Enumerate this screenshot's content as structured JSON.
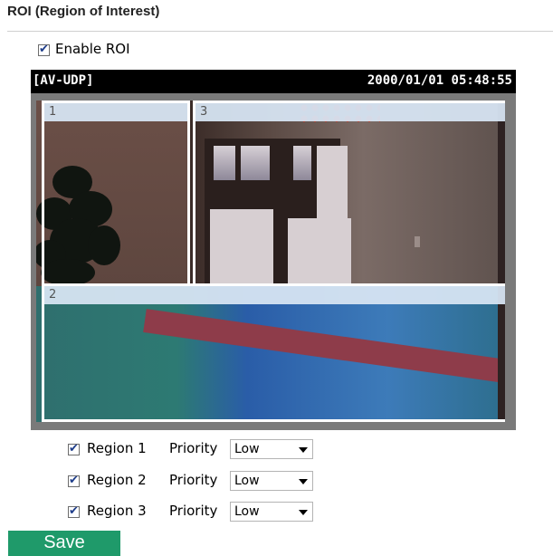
{
  "section": {
    "title": "ROI (Region of Interest)"
  },
  "enable_roi": {
    "label": "Enable ROI",
    "checked": true
  },
  "viewer": {
    "stream_label": "[AV-UDP]",
    "timestamp": "2000/01/01 05:48:55",
    "regions": [
      {
        "number": "1"
      },
      {
        "number": "2"
      },
      {
        "number": "3"
      }
    ]
  },
  "region_rows": [
    {
      "label": "Region 1",
      "checked": true,
      "priority_label": "Priority",
      "priority_value": "Low"
    },
    {
      "label": "Region 2",
      "checked": true,
      "priority_label": "Priority",
      "priority_value": "Low"
    },
    {
      "label": "Region 3",
      "checked": true,
      "priority_label": "Priority",
      "priority_value": "Low"
    }
  ],
  "save_label": "Save",
  "colors": {
    "save_button": "#1f9a6a",
    "region_header": "#d6e4f2",
    "checkmark": "#1e3d8a"
  },
  "icons": {
    "dropdown": "chevron-down-icon",
    "checkbox": "checkbox-icon"
  }
}
